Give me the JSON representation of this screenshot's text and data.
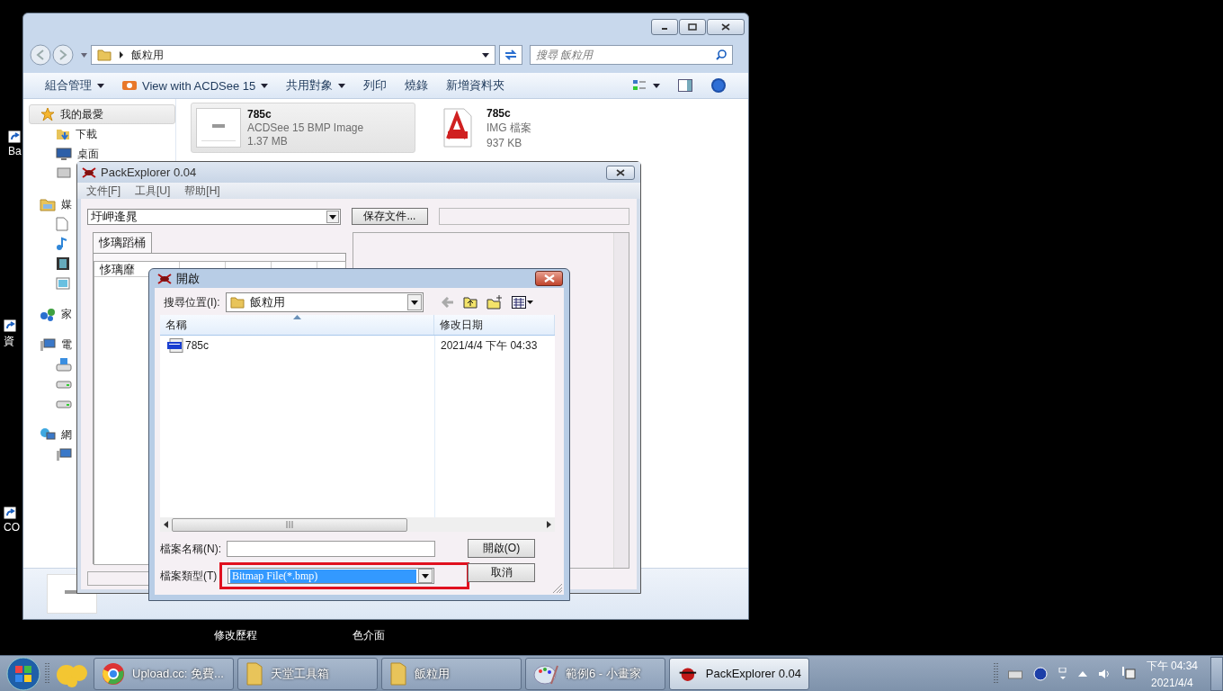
{
  "desktop": {
    "side_labels": [
      "Ba",
      "資",
      "CO"
    ],
    "bottom_labels": [
      "修改歷程",
      "色介面"
    ]
  },
  "explorer": {
    "address": {
      "path": "飯粒用"
    },
    "search": {
      "placeholder": "搜尋 飯粒用"
    },
    "toolbar": [
      {
        "label": "組合管理",
        "dropdown": true
      },
      {
        "label": "View with ACDSee 15",
        "dropdown": true
      },
      {
        "label": "共用對象",
        "dropdown": true
      },
      {
        "label": "列印",
        "dropdown": false
      },
      {
        "label": "燒錄",
        "dropdown": false
      },
      {
        "label": "新增資料夾",
        "dropdown": false
      }
    ],
    "sidebar": [
      {
        "label": "我的最愛",
        "selected": true,
        "children": [
          {
            "label": "下載",
            "selected": false
          },
          {
            "label": "桌面",
            "selected": false
          },
          {
            "selected": false
          }
        ]
      },
      {
        "label": "媒",
        "selected": false,
        "children": [
          {
            "selected": false
          },
          {
            "selected": false
          },
          {
            "selected": false
          },
          {
            "selected": false
          }
        ]
      },
      {
        "label": "家",
        "selected": false
      },
      {
        "label": "電",
        "selected": false,
        "children": [
          {
            "selected": false
          },
          {
            "selected": false
          },
          {
            "selected": false
          }
        ]
      },
      {
        "label": "網",
        "selected": false,
        "children": [
          {
            "selected": false
          }
        ]
      }
    ],
    "files": [
      {
        "name": "785c",
        "type": "ACDSee 15 BMP Image",
        "size": "1.37 MB",
        "selected": true,
        "kind": "bmp"
      },
      {
        "name": "785c",
        "type": "IMG 檔案",
        "size": "937 KB",
        "selected": false,
        "kind": "img"
      }
    ]
  },
  "pack_explorer": {
    "title": "PackExplorer 0.04",
    "menu": [
      "文件[F]",
      "工具[U]",
      "帮助[H]"
    ],
    "combo": "圩岬逄晁",
    "save_button": "保存文件...",
    "tabs": [
      {
        "label": "恀璃蹈桶",
        "selected": true
      }
    ],
    "list": {
      "columns": [
        "恀璃靡"
      ]
    }
  },
  "open_dialog": {
    "title": "開啟",
    "look_in_label": "搜尋位置(I):",
    "look_in": "飯粒用",
    "columns": [
      {
        "label": "名稱",
        "sorted": true
      },
      {
        "label": "修改日期",
        "sorted": false
      }
    ],
    "files": [
      {
        "name": "785c",
        "modified": "2021/4/4 下午 04:33",
        "selected": false
      }
    ],
    "filename_label": "檔案名稱(N):",
    "filetype_label": "檔案類型(T)",
    "filetype": "Bitmap File(*.bmp)",
    "filetype_highlighted": true,
    "buttons": [
      "開啟(O)",
      "取消"
    ]
  },
  "taskbar": {
    "buttons": [
      {
        "label": "Upload.cc: 免費...",
        "selected": false,
        "kind": "browser"
      },
      {
        "label": "天堂工具箱",
        "selected": false,
        "kind": "folder"
      },
      {
        "label": "飯粒用",
        "selected": false,
        "kind": "folder"
      },
      {
        "label": "範例6 - 小畫家",
        "selected": false,
        "kind": "paint"
      },
      {
        "label": "PackExplorer 0.04",
        "selected": true,
        "kind": "app"
      }
    ],
    "clock": {
      "time": "下午 04:34",
      "date": "2021/4/4"
    }
  }
}
